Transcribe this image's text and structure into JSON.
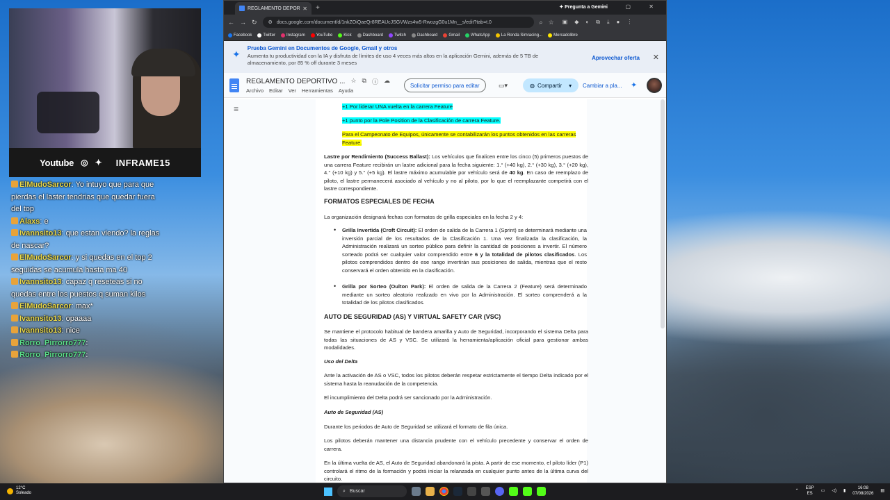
{
  "stream": {
    "social_site": "Youtube",
    "social_handle": "INFRAME15",
    "chat": [
      {
        "user": "ElMudoSarcor",
        "color": "#e9d84a",
        "text": ": Yo intuyo que para que pierdas el laster tendrias que quedar fuera del top"
      },
      {
        "user": "Alaxs",
        "color": "#e9d84a",
        "text": ": e"
      },
      {
        "user": "Ivannsito13",
        "color": "#e9d84a",
        "text": ": que estan viendo? la reglas de nascar?"
      },
      {
        "user": "ElMudoSarcor",
        "color": "#e9d84a",
        "text": ": y si quedas en el top 2 seguidas se acumula hasta ma 40"
      },
      {
        "user": "Ivannsito13",
        "color": "#e9d84a",
        "text": ": capaz q reseteas si no quedas entre los puestos q suman kilos"
      },
      {
        "user": "ElMudoSarcor",
        "color": "#e9d84a",
        "text": ": max*"
      },
      {
        "user": "Ivannsito13",
        "color": "#e9d84a",
        "text": ": opaaaa"
      },
      {
        "user": "Ivannsito13",
        "color": "#e9d84a",
        "text": ": nice"
      },
      {
        "user": "Rorro_Pirrorro777",
        "color": "#5be08a",
        "text": ":"
      },
      {
        "user": "Rorro_Pirrorro777",
        "color": "#5be08a",
        "text": ":"
      }
    ]
  },
  "browser": {
    "tab_title": "REGLAMENTO DEPORTIVO BTC",
    "gemini_tab": "Pregunta a Gemini",
    "url": "docs.google.com/document/d/1nkZOiQaeQr8REAUcJSGVWzs4w5-RwozgG0u1Mn__s/edit?tab=t.0",
    "bookmarks": [
      "Facebook",
      "Twitter",
      "Instagram",
      "YouTube",
      "Kick",
      "Dashboard",
      "Twitch",
      "Dashboard",
      "Gmail",
      "WhatsApp",
      "La Ronda Simracing...",
      "Mercadolibre"
    ]
  },
  "banner": {
    "title": "Prueba Gemini en Documentos de Google, Gmail y otros",
    "body": "Aumenta tu productividad con la IA y disfruta de límites de uso 4 veces más altos en la aplicación Gemini, además de 5 TB de almacenamiento, por 85 % off durante 3 meses",
    "offer": "Aprovechar oferta"
  },
  "docs": {
    "title": "REGLAMENTO DEPORTIVO ...",
    "menu": [
      "Archivo",
      "Editar",
      "Ver",
      "Herramientas",
      "Ayuda"
    ],
    "request_edit": "Solicitar permiso para editar",
    "share": "Compartir",
    "switch": "Cambiar a pla..."
  },
  "document": {
    "line1": "+1 Por liderar UNA vuelta en la carrera Feature",
    "line2": "+1 punto por la Pole Position de la Clasificación de carrera Feature.",
    "line3": "Para el Campeonato de Equipos, únicamente se contabilizarán los puntos obtenidos en las carreras Feature.",
    "ballast_label": "Lastre por Rendimiento (Success Ballast):",
    "ballast_text_a": " Los vehículos que finalicen entre los cinco (5) primeros puestos de una carrera Feature recibirán un lastre adicional para la fecha siguiente: 1.° (+40 kg), 2.° (+30 kg), 3.° (+20 kg), 4.° (+10 kg) y 5.° (+5 kg). El lastre máximo acumulable por vehículo será de ",
    "ballast_bold": "40 kg",
    "ballast_text_b": ". En caso de reemplazo de piloto, el lastre permanecerá asociado al vehículo y no al piloto, por lo que el reemplazante competirá con el lastre correspondiente.",
    "h_formats": "FORMATOS ESPECIALES DE FECHA",
    "formats_intro": "La organización designará fechas con formatos de grilla especiales en la fecha 2 y 4:",
    "b1_label": "Grilla Invertida (Croft Circuit):",
    "b1_text_a": " El orden de salida de la Carrera 1 (Sprint) se determinará mediante una inversión parcial de los resultados de la Clasificación 1. Una vez finalizada la clasificación, la Administración realizará un sorteo público para definir la cantidad de posiciones a invertir. El número sorteado podrá ser cualquier valor comprendido entre ",
    "b1_bold": "6 y la totalidad de pilotos clasificados",
    "b1_text_b": ". Los pilotos comprendidos dentro de ese rango invertirán sus posiciones de salida, mientras que el resto conservará el orden obtenido en la clasificación.",
    "b2_label": "Grilla por Sorteo (Oulton Park):",
    "b2_text": " El orden de salida de la Carrera 2 (Feature) será determinado mediante un sorteo aleatorio realizado en vivo por la Administración. El sorteo comprenderá a la totalidad de los pilotos clasificados.",
    "h_safety": "AUTO DE SEGURIDAD (AS) Y VIRTUAL SAFETY CAR (VSC)",
    "safety_p": "Se mantiene el protocolo habitual de bandera amarilla y Auto de Seguridad, incorporando el sistema Delta para todas las situaciones de AS y VSC. Se utilizará la herramienta/aplicación oficial para gestionar ambas modalidades.",
    "h_delta": "Uso del Delta",
    "delta_p1": "Ante la activación de AS o VSC, todos los pilotos deberán respetar estrictamente el tiempo Delta indicado por el sistema hasta la reanudación de la competencia.",
    "delta_p2": "El incumplimiento del Delta podrá ser sancionado por la Administración.",
    "h_as": "Auto de Seguridad (AS)",
    "as_p1": "Durante los periodos de Auto de Seguridad se utilizará el formato de fila única.",
    "as_p2": "Los pilotos deberán mantener una distancia prudente con el vehículo precedente y conservar el orden de carrera.",
    "as_p3": "En la última vuelta de AS, el Auto de Seguridad abandonará la pista. A partir de ese momento, el piloto líder (P1) controlará el ritmo de la formación y podrá iniciar la relanzada en cualquier punto antes de la última curva del circuito."
  },
  "taskbar": {
    "temp": "12°C",
    "weather": "Soleado",
    "search": "Buscar",
    "lang1": "ESP",
    "lang2": "ES",
    "time": "16:08",
    "date": "07/08/2026"
  }
}
